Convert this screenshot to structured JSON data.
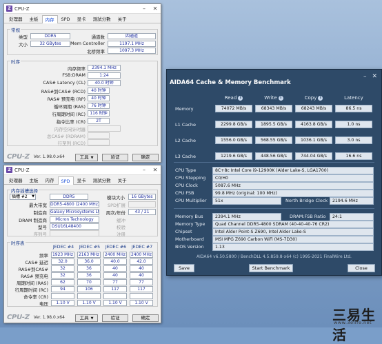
{
  "cpuz1": {
    "title": "CPU-Z",
    "tabs": [
      "处理器",
      "主板",
      "内存",
      "SPD",
      "显卡",
      "測試分數",
      "关于"
    ],
    "general": {
      "group": "常规",
      "type_label": "类型",
      "type": "DDR5",
      "size_label": "大小",
      "size": "32 GBytes",
      "channels_label": "通道数",
      "channels": "四通道",
      "memctrl_label": "Mem Controller",
      "memctrl": "1197.1 MHz",
      "nb_label": "北桥频率",
      "nb": "1097.3 MHz"
    },
    "timing": {
      "group": "时序",
      "rows": [
        {
          "label": "内存频率",
          "value": "2394.1 MHz"
        },
        {
          "label": "FSB:DRAM",
          "value": "1:24"
        },
        {
          "label": "CAS# Latency (CL)",
          "value": "40.0 时钟"
        },
        {
          "label": "RAS#到CAS# (RCD)",
          "value": "40 时钟"
        },
        {
          "label": "RAS# 预充电 (RP)",
          "value": "40 时钟"
        },
        {
          "label": "循环周期 (RAS)",
          "value": "76 时钟"
        },
        {
          "label": "行周期时间 (RC)",
          "value": "116 时钟"
        },
        {
          "label": "指令比率 (CR)",
          "value": "2T"
        }
      ],
      "dim_rows": [
        "内存空闲计时器",
        "总CAS# (RDRAM)",
        "行至列 (RCD)"
      ]
    },
    "logo": "CPU-Z",
    "version": "Ver. 1.98.0.x64",
    "tools": "工具",
    "validate": "验证",
    "ok": "确定"
  },
  "cpuz2": {
    "title": "CPU-Z",
    "tabs": [
      "处理器",
      "主板",
      "内存",
      "SPD",
      "显卡",
      "測試分數",
      "关于"
    ],
    "slot": {
      "group": "内存插槽选择",
      "slot_value": "插槽 #2",
      "type": "DDR5",
      "module_size_label": "模块大小",
      "module_size": "16 GBytes",
      "max_bw_label": "最大带宽",
      "max_bw": "DDR5-4800 (2400 MHz)",
      "spd_ext_label": "SPD扩展",
      "mfr_label": "制造商",
      "mfr": "Galaxy Microsystems Ltd.",
      "week_label": "周次/年份",
      "week": "43 / 21",
      "dram_mfr_label": "DRAM 制造商",
      "dram_mfr": "Micron Technology",
      "buffered_label": "缓冲",
      "part_label": "型号",
      "part": "DSU16L48400",
      "ecc_label": "校验",
      "serial_label": "序列号",
      "register_label": "注册"
    },
    "timings": {
      "group": "时序表",
      "headers": [
        "JEDEC #4",
        "JEDEC #5",
        "JEDEC #6",
        "JEDEC #7"
      ],
      "rows": [
        {
          "label": "频率",
          "values": [
            "1923 MHz",
            "2163 MHz",
            "2400 MHz",
            "2400 MHz"
          ]
        },
        {
          "label": "CAS# 延迟",
          "values": [
            "32.0",
            "36.0",
            "40.0",
            "42.0"
          ]
        },
        {
          "label": "RAS#到CAS#",
          "values": [
            "32",
            "36",
            "40",
            "40"
          ]
        },
        {
          "label": "RAS# 预充电",
          "values": [
            "32",
            "36",
            "40",
            "40"
          ]
        },
        {
          "label": "周期时间 (RAS)",
          "values": [
            "62",
            "70",
            "77",
            "77"
          ]
        },
        {
          "label": "行周期时间 (RC)",
          "values": [
            "94",
            "106",
            "117",
            "117"
          ]
        },
        {
          "label": "命令率 (CR)",
          "values": [
            "",
            "",
            "",
            ""
          ]
        },
        {
          "label": "电压",
          "values": [
            "1.10 V",
            "1.10 V",
            "1.10 V",
            "1.10 V"
          ]
        }
      ]
    },
    "logo": "CPU-Z",
    "version": "Ver. 1.98.0.x64",
    "tools": "工具",
    "validate": "验证",
    "ok": "确定"
  },
  "aida": {
    "title": "AIDA64 Cache & Memory Benchmark",
    "headers": [
      "Read",
      "Write",
      "Copy",
      "Latency"
    ],
    "bench": [
      {
        "label": "Memory",
        "values": [
          "74072 MB/s",
          "68343 MB/s",
          "68243 MB/s",
          "86.5 ns"
        ]
      },
      {
        "label": "L1 Cache",
        "values": [
          "2299.8 GB/s",
          "1895.5 GB/s",
          "4163.8 GB/s",
          "1.0 ns"
        ]
      },
      {
        "label": "L2 Cache",
        "values": [
          "1556.0 GB/s",
          "568.55 GB/s",
          "1036.1 GB/s",
          "3.0 ns"
        ]
      },
      {
        "label": "L3 Cache",
        "values": [
          "1219.6 GB/s",
          "448.56 GB/s",
          "744.04 GB/s",
          "16.6 ns"
        ]
      }
    ],
    "cpu_type_label": "CPU Type",
    "cpu_type": "8C+8c Intel Core i9-12900K  (Alder Lake-S, LGA1700)",
    "cpu_step_label": "CPU Stepping",
    "cpu_step": "C0/H0",
    "cpu_clock_label": "CPU Clock",
    "cpu_clock": "5087.6 MHz",
    "cpu_fsb_label": "CPU FSB",
    "cpu_fsb": "99.8 MHz  (original: 100 MHz)",
    "cpu_mult_label": "CPU Multiplier",
    "cpu_mult": "51x",
    "nb_clock_label": "North Bridge Clock",
    "nb_clock": "2194.6 MHz",
    "mem_bus_label": "Memory Bus",
    "mem_bus": "2394.1 MHz",
    "dram_fsb_label": "DRAM:FSB Ratio",
    "dram_fsb": "24:1",
    "mem_type_label": "Memory Type",
    "mem_type": "Quad Channel DDR5-4800 SDRAM  (40-40-40-76 CR2)",
    "chipset_label": "Chipset",
    "chipset": "Intel Alder Point-S Z690, Intel Alder Lake-S",
    "mobo_label": "Motherboard",
    "mobo": "MSI MPG Z690 Carbon WiFi (MS-7D30)",
    "bios_label": "BIOS Version",
    "bios": "1.13",
    "footer": "AIDA64 v6.50.5800 / BenchDLL 4.5.859.8-x64  (c) 1995-2021 FinalWire Ltd.",
    "save": "Save",
    "start": "Start Benchmark",
    "close": "Close"
  },
  "watermark": "三易生活",
  "watermark_url": "www.3elife.net"
}
